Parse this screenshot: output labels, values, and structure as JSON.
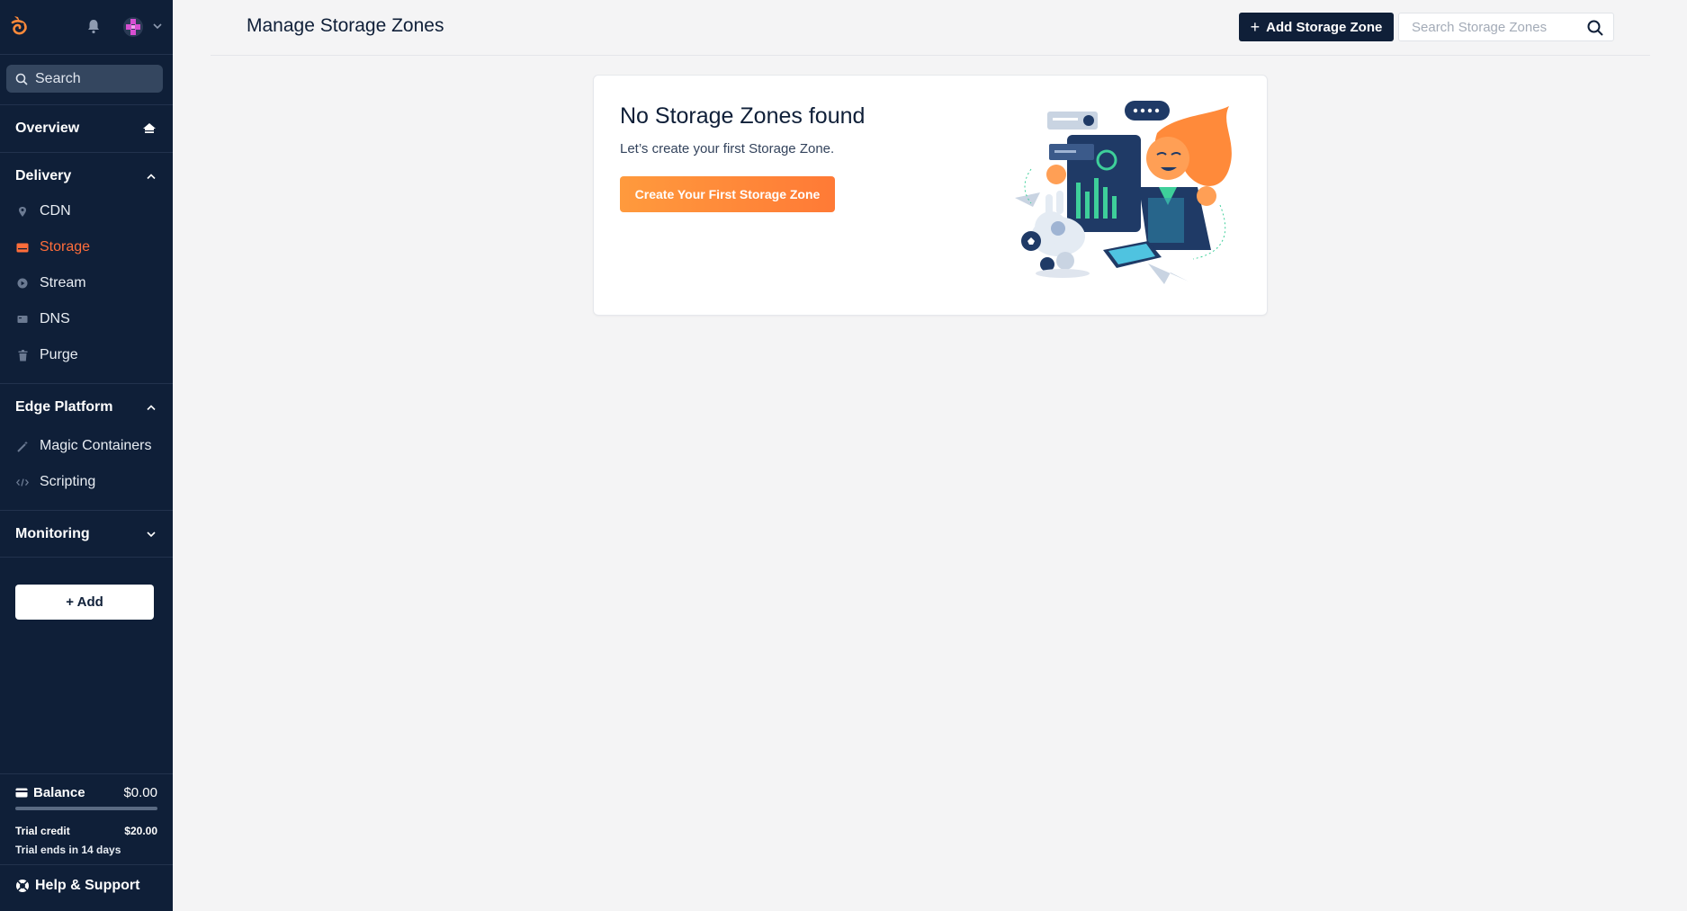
{
  "sidebar": {
    "search_label": "Search",
    "overview_label": "Overview",
    "sections": {
      "delivery": "Delivery",
      "edge": "Edge Platform",
      "monitoring": "Monitoring"
    },
    "delivery_items": [
      {
        "label": "CDN",
        "icon": "map-pin-icon"
      },
      {
        "label": "Storage",
        "icon": "storage-icon",
        "active": true
      },
      {
        "label": "Stream",
        "icon": "play-icon"
      },
      {
        "label": "DNS",
        "icon": "dns-icon"
      },
      {
        "label": "Purge",
        "icon": "trash-icon"
      }
    ],
    "edge_items": [
      {
        "label": "Magic Containers",
        "icon": "magic-wand-icon"
      },
      {
        "label": "Scripting",
        "icon": "code-icon"
      }
    ],
    "add_label": "+ Add",
    "balance": {
      "label": "Balance",
      "value": "$0.00",
      "trial_label": "Trial credit",
      "trial_value": "$20.00",
      "trial_ends": "Trial ends in 14 days"
    },
    "help_label": "Help & Support"
  },
  "header": {
    "title": "Manage Storage Zones",
    "add_button": "Add Storage Zone",
    "search_placeholder": "Search Storage Zones"
  },
  "empty_state": {
    "title": "No Storage Zones found",
    "subtitle": "Let’s create your first Storage Zone.",
    "button": "Create Your First Storage Zone"
  },
  "colors": {
    "sidebar_bg": "#0f1f38",
    "accent": "#ff6d3a",
    "cta": "#ff8a3a",
    "page_bg": "#f4f4f5"
  }
}
